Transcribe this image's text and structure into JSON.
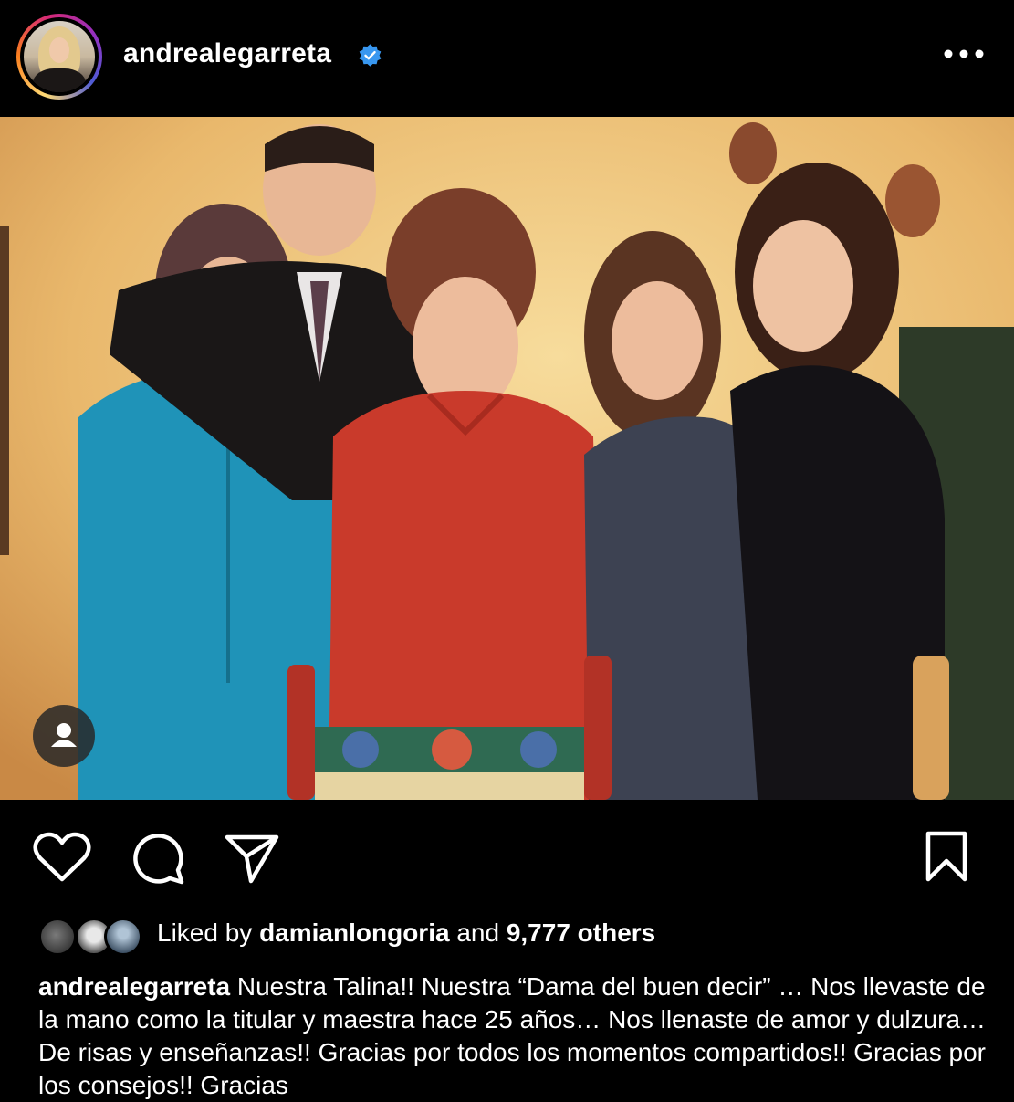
{
  "post": {
    "username": "andrealegarreta",
    "verified": true
  },
  "photo": {
    "alt": "Group photo of five people in a TV set with a decorated wooden chair"
  },
  "likes": {
    "prefix": "Liked by ",
    "user": "damianlongoria",
    "middle": " and ",
    "count": "9,777 others"
  },
  "caption": {
    "username": "andrealegarreta",
    "text": " Nuestra Talina!! Nuestra “Dama del buen decir” … Nos llevaste de la mano como la titular y maestra hace 25 años… Nos llenaste de amor y dulzura… De risas y enseñanzas!! Gracias por todos los momentos compartidos!! Gracias por los consejos!! Gracias"
  },
  "icons": {
    "more": "more-options-icon",
    "like": "heart-icon",
    "comment": "comment-icon",
    "share": "send-icon",
    "save": "bookmark-icon",
    "tag": "user-tag-icon",
    "verified": "verified-badge-icon"
  },
  "colors": {
    "background": "#000000",
    "text": "#ffffff",
    "verified": "#3897f0"
  }
}
